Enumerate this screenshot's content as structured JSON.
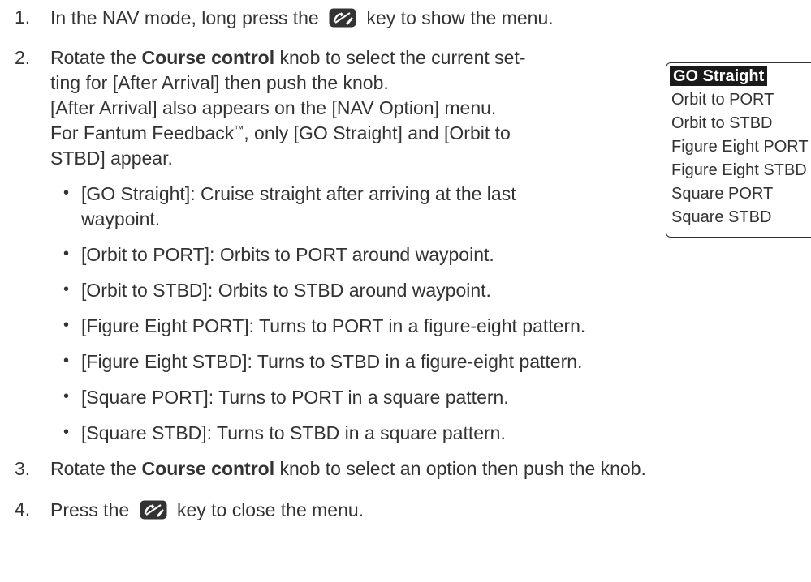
{
  "steps": {
    "s1": {
      "num": "1.",
      "before": "In the NAV mode, long press the",
      "key_icon": "autopilot-nav-key-icon",
      "after": "key to show the menu."
    },
    "s2": {
      "num": "2.",
      "l1_pre": "Rotate the ",
      "l1_bold": "Course control",
      "l1_post": " knob to select the current set-",
      "l2": "ting for [After Arrival] then push the knob.",
      "l3": "[After Arrival] also appears on the [NAV Option] menu.",
      "l4_pre": "For Fantum Feedback",
      "l4_tm": "™",
      "l4_post": ", only [GO Straight] and [Orbit to",
      "l5": "STBD] appear.",
      "bullets": [
        "[GO Straight]: Cruise straight after arriving at the last",
        "waypoint.",
        "[Orbit to PORT]: Orbits to PORT around waypoint.",
        "[Orbit to STBD]: Orbits to STBD around waypoint.",
        "[Figure Eight PORT]: Turns to PORT in a figure-eight pattern.",
        "[Figure Eight STBD]: Turns to STBD in a figure-eight pattern.",
        "[Square PORT]: Turns to PORT in a square pattern.",
        "[Square STBD]: Turns to STBD in a square pattern."
      ]
    },
    "s3": {
      "num": "3.",
      "pre": "Rotate the ",
      "bold": "Course control",
      "post": " knob to select an option then push the knob."
    },
    "s4": {
      "num": "4.",
      "before": "Press the",
      "key_icon": "autopilot-nav-key-icon",
      "after": "key to close the menu."
    }
  },
  "menu": {
    "items": [
      "GO Straight",
      "Orbit to PORT",
      "Orbit to STBD",
      "Figure Eight PORT",
      "Figure Eight STBD",
      "Square PORT",
      "Square STBD"
    ],
    "selected_index": 0
  }
}
